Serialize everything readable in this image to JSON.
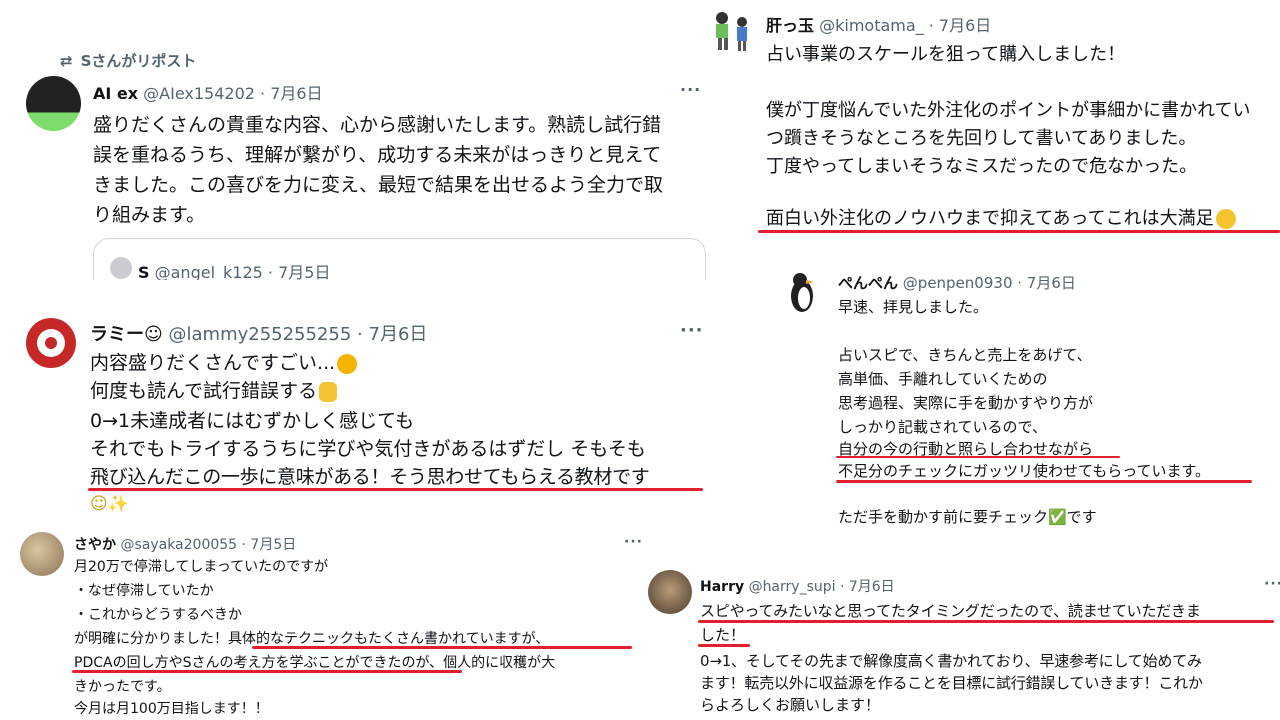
{
  "colors": {
    "text": "#0f1419",
    "meta": "#536471",
    "underline": "#e0202c",
    "border": "#cfd9de"
  },
  "repost": {
    "label": "Sさんがリポスト",
    "name": "AI ex",
    "handle_date": "@AIex154202 · 7月6日",
    "more": "···",
    "lines": [
      "盛りだくさんの貴重な内容、心から感謝いたします。熟読し試行錯",
      "誤を重ねるうち、理解が繋がり、成功する未来がはっきりと見えて",
      "きました。この喜びを力に変え、最短で結果を出せるよう全力で取",
      "り組みます。"
    ],
    "quote": {
      "name": "S",
      "handle_date": "@angel_k125 · 7月5日"
    }
  },
  "kimotama": {
    "name": "肝っ玉",
    "handle_date": "@kimotama_ · 7月6日",
    "lines": [
      "占い事業のスケールを狙って購入しました！",
      "",
      "僕が丁度悩んでいた外注化のポイントが事細かに書かれてい",
      "つ躓きそうなところを先回りして書いてありました。",
      "丁度やってしまいそうなミスだったので危なかった。",
      "",
      "面白い外注化のノウハウまで抑えてあってこれは大満足"
    ]
  },
  "lammy": {
    "name": "ラミー☺",
    "handle_date": "@lammy255255255 · 7月6日",
    "more": "···",
    "lines": [
      "内容盛りだくさんですごい...",
      "何度も読んで試行錯誤する",
      "0→1未達成者にはむずかしく感じても",
      "それでもトライするうちに学びや気付きがあるはずだし そもそも",
      "飛び込んだこの一歩に意味がある！そう思わせてもらえる教材です",
      "☺✨"
    ]
  },
  "penpen": {
    "name": "ぺんぺん",
    "handle_date": "@penpen0930 · 7月6日",
    "lines": [
      "早速、拝見しました。",
      "",
      "占いスピで、きちんと売上をあげて、",
      "高単価、手離れしていくための",
      "思考過程、実際に手を動かすやり方が",
      "しっかり記載されているので、",
      "自分の今の行動と照らし合わせながら",
      "不足分のチェックにガッツリ使わせてもらっています。",
      "",
      "ただ手を動かす前に要チェック✅です"
    ]
  },
  "sayaka": {
    "name": "さやか",
    "handle_date": "@sayaka200055 · 7月5日",
    "more": "···",
    "lines": [
      "月20万で停滞してしまっていたのですが",
      "・なぜ停滞していたか",
      "・これからどうするべきか",
      "が明確に分かりました！具体的なテクニックもたくさん書かれていますが、",
      "PDCAの回し方やSさんの考え方を学ぶことができたのが、個人的に収穫が大",
      "きかったです。",
      "今月は月100万目指します！！"
    ]
  },
  "harry": {
    "name": "Harry",
    "handle_date": "@harry_supi · 7月6日",
    "more": "···",
    "lines": [
      "スピやってみたいなと思ってたタイミングだったので、読ませていただきま",
      "した！",
      "0→1、そしてその先まで解像度高く書かれており、早速参考にして始めてみ",
      "ます！転売以外に収益源を作ることを目標に試行錯誤していきます！これか",
      "らよろしくお願いします！"
    ]
  }
}
